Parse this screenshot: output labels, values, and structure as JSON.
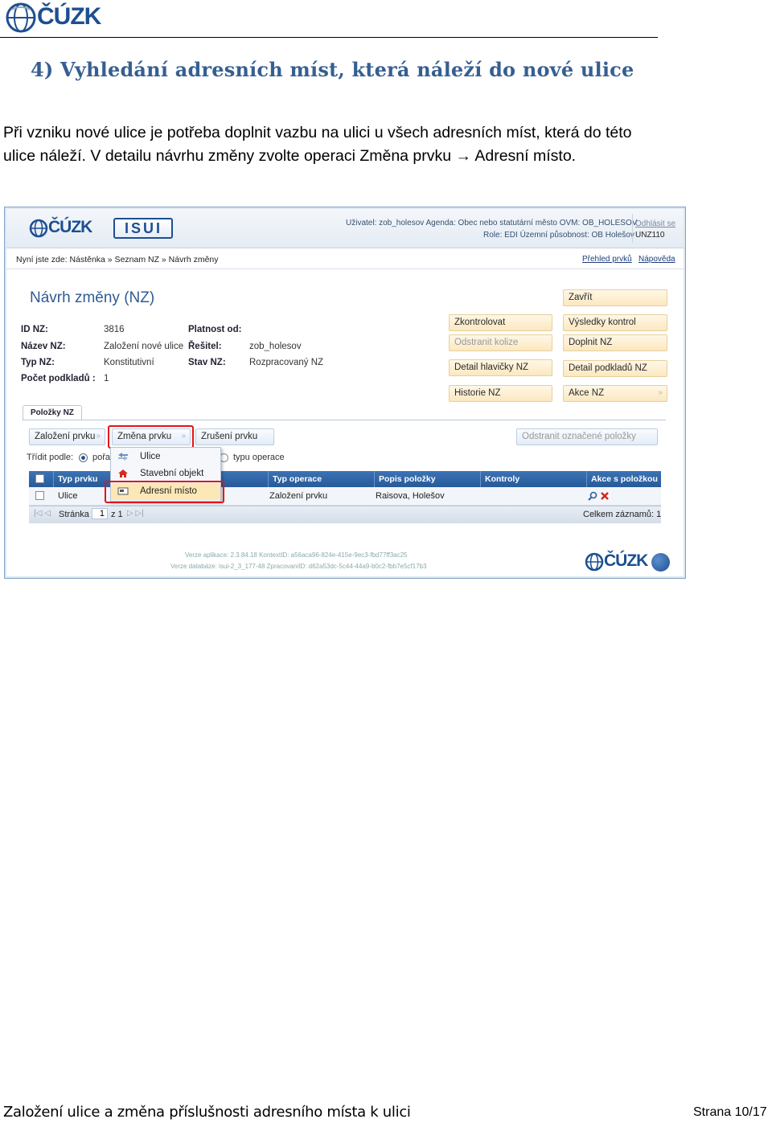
{
  "doc": {
    "logo_text": "ČÚZK",
    "heading": "4) Vyhledání adresních míst, která náleží do nové ulice",
    "paragraph_line1": "Při vzniku nové ulice je potřeba doplnit vazbu na ulici u všech adresních míst, která do této",
    "paragraph_line2": "ulice náleží. V detailu návrhu změny zvolte operaci Změna prvku → Adresní místo.",
    "footer_left": "Založení ulice a změna příslušnosti adresního místa k ulici",
    "footer_right": "Strana 10/17"
  },
  "app": {
    "logo_text": "ČÚZK",
    "isui_text": "ISUI",
    "user_line1": "Uživatel: zob_holesov   Agenda: Obec nebo statutární město   OVM: OB_HOLESOV",
    "user_line2": "Role: EDI   Územní působnost: OB Holešov",
    "logout": "Odhlásit se",
    "session": "UNZ110",
    "breadcrumb": "Nyní jste zde: Nástěnka » Seznam NZ » Návrh změny",
    "link_overview": "Přehled prvků",
    "link_help": "Nápověda",
    "page_title": "Návrh změny (NZ)",
    "fields": {
      "id_label": "ID NZ:",
      "id_value": "3816",
      "name_label": "Název NZ:",
      "name_value": "Založení nové ulice",
      "type_label": "Typ NZ:",
      "type_value": "Konstitutivní",
      "count_label": "Počet podkladů :",
      "count_value": "1",
      "valid_label": "Platnost od:",
      "valid_value": "",
      "solver_label": "Řešitel:",
      "solver_value": "zob_holesov",
      "state_label": "Stav NZ:",
      "state_value": "Rozpracovaný NZ"
    },
    "buttons": {
      "close": "Zavřít",
      "check": "Zkontrolovat",
      "check_results": "Výsledky kontrol",
      "remove_collisions": "Odstranit kolize",
      "complete": "Doplnit NZ",
      "header_detail": "Detail hlavičky NZ",
      "docs_detail": "Detail podkladů NZ",
      "history": "Historie NZ",
      "actions": "Akce NZ"
    },
    "tab_items": "Položky NZ",
    "op_create": "Založení prvku",
    "op_change": "Změna prvku",
    "op_cancel": "Zrušení prvku",
    "op_remove_marked": "Odstranit označené položky",
    "sort_label": "Třídit podle:",
    "sort_opt1": "pořa",
    "sort_opt2": "typu operace",
    "menu": [
      "Ulice",
      "Stavební objekt",
      "Adresní místo"
    ],
    "grid": {
      "headers": [
        "Typ prvku",
        "Typ operace",
        "Popis položky",
        "Kontroly",
        "Akce s položkou"
      ],
      "row": [
        "Ulice",
        "Založení prvku",
        "Raisova, Holešov",
        ""
      ],
      "page_label": "Stránka",
      "page_value": "1",
      "page_of": "z 1",
      "total": "Celkem záznamů: 1"
    },
    "version_line1": "Verze aplikace: 2.3.84.18 KontextID: a56aca96-824e-415e-9ec3-fbd77ff3ac25",
    "version_line2": "Verze databáze: isui-2_3_177-48 ZpracovaniID: d62a53dc-5c44-44a9-b0c2-fbb7e5cf17b3",
    "footer_logo_text": "ČÚZK"
  },
  "colors": {
    "heading": "#365f91",
    "grid_header": "#2e63a6",
    "highlight": "#e0151b",
    "button_bg": "#fbe8c0"
  }
}
